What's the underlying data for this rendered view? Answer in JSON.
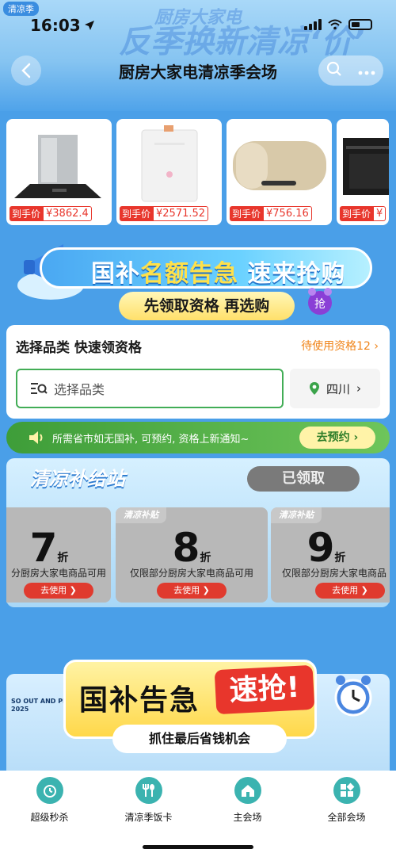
{
  "status_bar": {
    "time": "16:03"
  },
  "header": {
    "season_tag": "清凉季",
    "bg_line1": "厨房大家电",
    "bg_line2": "反季换新清凉‘价’",
    "title": "厨房大家电清凉季会场"
  },
  "products": [
    {
      "price_label": "到手价",
      "price": "¥3862.4",
      "icon": "range-hood"
    },
    {
      "price_label": "到手价",
      "price": "¥2571.52",
      "icon": "gas-water-heater"
    },
    {
      "price_label": "到手价",
      "price": "¥756.16",
      "icon": "electric-water-heater"
    },
    {
      "price_label": "到手价",
      "price": "¥",
      "icon": "built-in-oven"
    }
  ],
  "subsidy_banner": {
    "title_part1": "国补",
    "title_part2": "名额告急",
    "title_part3": "速来抢购",
    "subtitle": "先领取资格 再选购",
    "grab_badge": "抢"
  },
  "select_card": {
    "title": "选择品类 快速领资格",
    "pending_link": "待使用资格12",
    "category_placeholder": "选择品类",
    "region": "四川"
  },
  "notice": {
    "text": "所需省市如无国补, 可预约, 资格上新通知~",
    "button": "去预约"
  },
  "station": {
    "title": "清凉补给站",
    "claimed_button": "已领取",
    "coupons": [
      {
        "tag": "清凉补贴",
        "discount": "7",
        "unit": "折",
        "desc": "分厨房大家电商品可用",
        "use": "去使用"
      },
      {
        "tag": "清凉补贴",
        "discount": "8",
        "unit": "折",
        "desc": "仅限部分厨房大家电商品可用",
        "use": "去使用"
      },
      {
        "tag": "清凉补贴",
        "discount": "9",
        "unit": "折",
        "desc": "仅限部分厨房大家电商品",
        "use": "去使用"
      }
    ]
  },
  "urgent_banner": {
    "title": "国补告急",
    "grab": "速抢!",
    "subtitle": "抓住最后省钱机会",
    "corner_text_1": "SO OUT AND PLAY",
    "corner_text_2": "2025"
  },
  "bottom_nav": [
    {
      "label": "超级秒杀",
      "icon": "clock-icon"
    },
    {
      "label": "清凉季饭卡",
      "icon": "fork-spoon-icon"
    },
    {
      "label": "主会场",
      "icon": "home-icon"
    },
    {
      "label": "全部会场",
      "icon": "grid-icon"
    }
  ],
  "colors": {
    "accent_red": "#e8362c",
    "accent_green": "#42ad56",
    "page_blue": "#4a9fe8",
    "link_orange": "#f08419"
  }
}
